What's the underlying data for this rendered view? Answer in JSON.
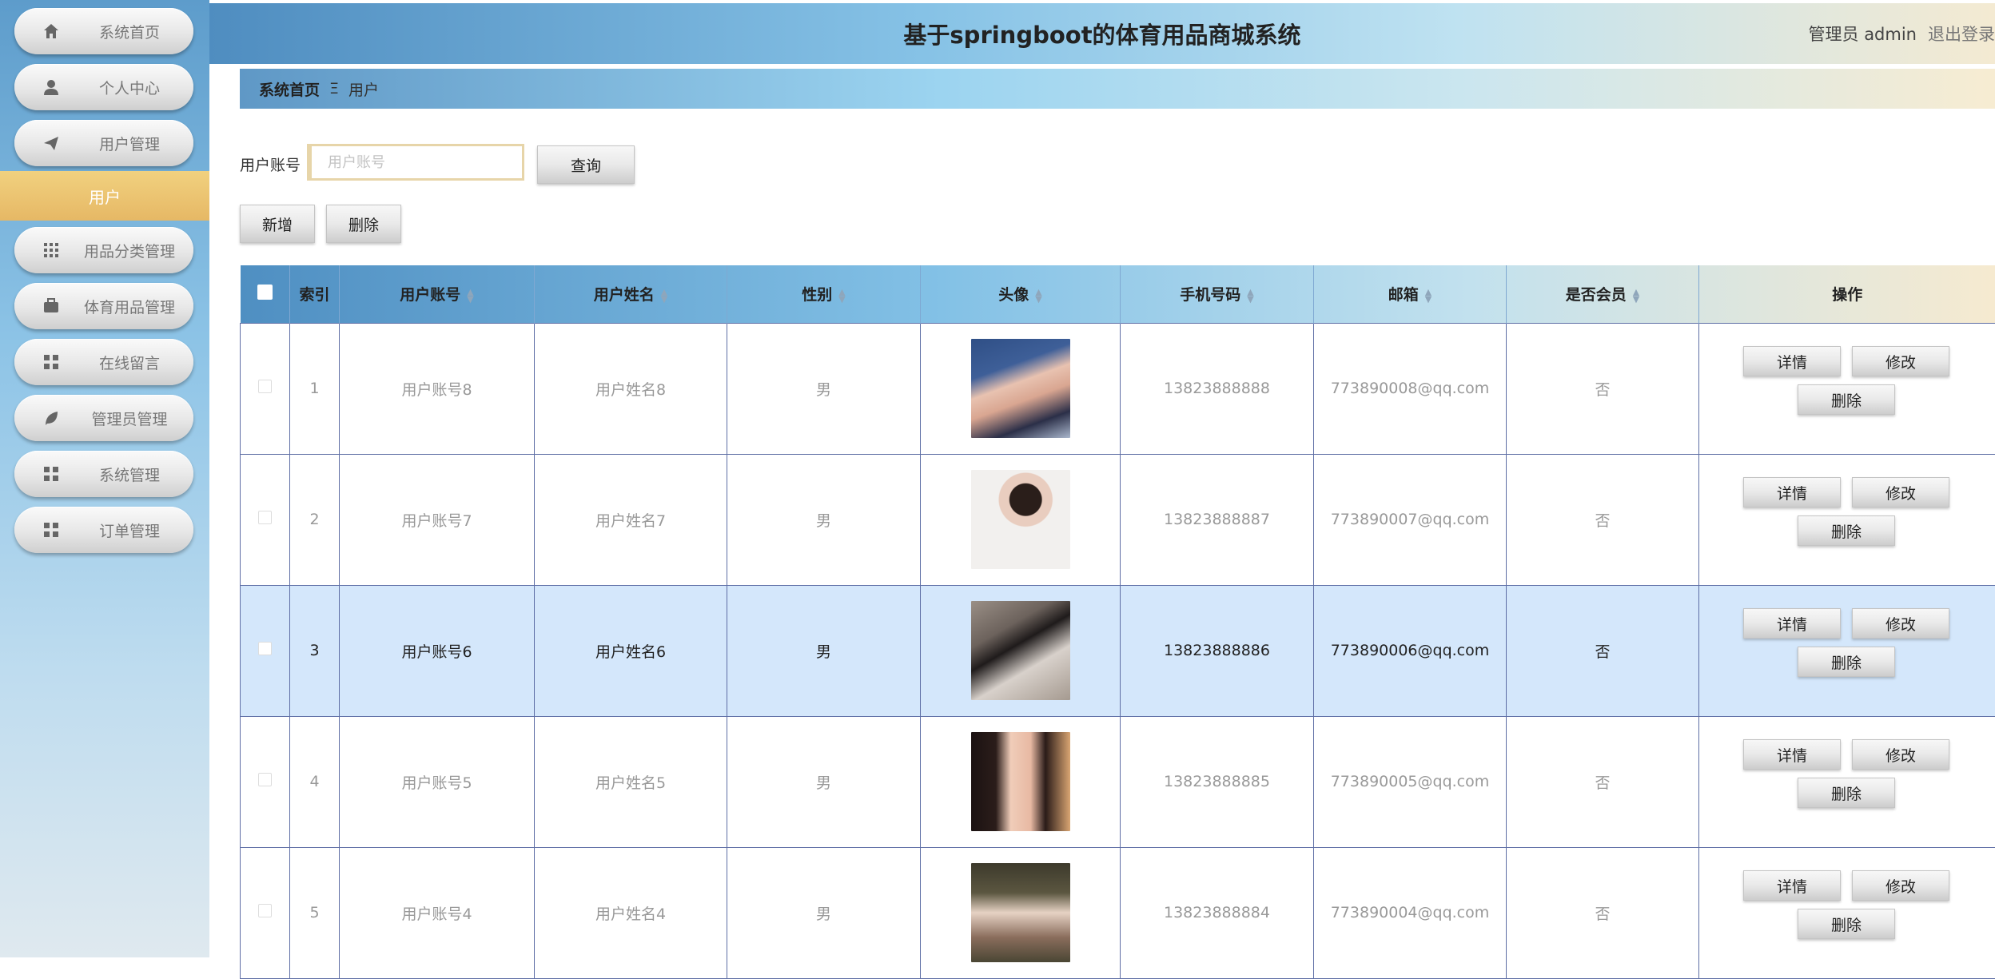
{
  "app": {
    "title": "基于springboot的体育用品商城系统",
    "user_label": "管理员 admin",
    "logout": "退出登录"
  },
  "sidebar": {
    "items": [
      {
        "label": "系统首页",
        "icon": "home-icon"
      },
      {
        "label": "个人中心",
        "icon": "user-icon"
      },
      {
        "label": "用户管理",
        "icon": "paper-plane-icon"
      },
      {
        "label": "用品分类管理",
        "icon": "grid-icon"
      },
      {
        "label": "体育用品管理",
        "icon": "briefcase-icon"
      },
      {
        "label": "在线留言",
        "icon": "grid-icon"
      },
      {
        "label": "管理员管理",
        "icon": "leaf-icon"
      },
      {
        "label": "系统管理",
        "icon": "grid-icon"
      },
      {
        "label": "订单管理",
        "icon": "grid-icon"
      }
    ],
    "active_sub_item": "用户"
  },
  "breadcrumb": {
    "home": "系统首页",
    "separator": "Ξ",
    "current": "用户"
  },
  "search": {
    "label": "用户账号",
    "placeholder": "用户账号",
    "button": "查询"
  },
  "actions": {
    "add": "新增",
    "delete": "删除"
  },
  "table": {
    "headers": {
      "index": "索引",
      "account": "用户账号",
      "name": "用户姓名",
      "gender": "性别",
      "avatar": "头像",
      "phone": "手机号码",
      "email": "邮箱",
      "member": "是否会员",
      "ops": "操作"
    },
    "row_buttons": {
      "detail": "详情",
      "edit": "修改",
      "delete": "删除"
    },
    "rows": [
      {
        "index": "1",
        "account": "用户账号8",
        "name": "用户姓名8",
        "gender": "男",
        "phone": "13823888888",
        "email": "773890008@qq.com",
        "member": "否"
      },
      {
        "index": "2",
        "account": "用户账号7",
        "name": "用户姓名7",
        "gender": "男",
        "phone": "13823888887",
        "email": "773890007@qq.com",
        "member": "否"
      },
      {
        "index": "3",
        "account": "用户账号6",
        "name": "用户姓名6",
        "gender": "男",
        "phone": "13823888886",
        "email": "773890006@qq.com",
        "member": "否"
      },
      {
        "index": "4",
        "account": "用户账号5",
        "name": "用户姓名5",
        "gender": "男",
        "phone": "13823888885",
        "email": "773890005@qq.com",
        "member": "否"
      },
      {
        "index": "5",
        "account": "用户账号4",
        "name": "用户姓名4",
        "gender": "男",
        "phone": "13823888884",
        "email": "773890004@qq.com",
        "member": "否"
      }
    ]
  },
  "colors": {
    "accent_gold": "#e6b865",
    "header_blue": "#4f8fc2",
    "highlight_row": "#d4e7fb"
  }
}
